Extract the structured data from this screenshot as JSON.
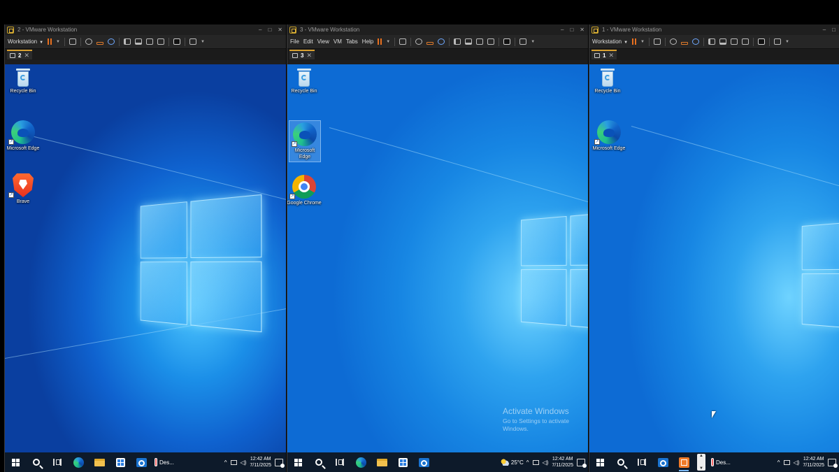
{
  "windows": [
    {
      "title": "2 - VMware Workstation",
      "menu_label": "Workstation",
      "tab_label": "2",
      "desktop_icons": [
        "Recycle Bin",
        "Microsoft Edge",
        "Brave"
      ],
      "weather": "Des...",
      "clock_time": "12:42 AM",
      "clock_date": "7/11/2025"
    },
    {
      "title": "3 - VMware Workstation",
      "menu": [
        "File",
        "Edit",
        "View",
        "VM",
        "Tabs",
        "Help"
      ],
      "tab_label": "3",
      "desktop_icons": [
        "Recycle Bin",
        "Microsoft Edge",
        "Google Chrome"
      ],
      "activate_title": "Activate Windows",
      "activate_sub": "Go to Settings to activate Windows.",
      "weather": "25°C",
      "clock_time": "12:42 AM",
      "clock_date": "7/11/2025"
    },
    {
      "title": "1 - VMware Workstation",
      "menu_label": "Workstation",
      "tab_label": "1",
      "desktop_icons": [
        "Recycle Bin",
        "Microsoft Edge"
      ],
      "weather": "Des...",
      "clock_time": "12:42 AM",
      "clock_date": "7/11/2025"
    }
  ],
  "colors": {
    "vmware_accent": "#d9a030",
    "pause_orange": "#e8701f",
    "taskbar": "#0d1a2a"
  }
}
